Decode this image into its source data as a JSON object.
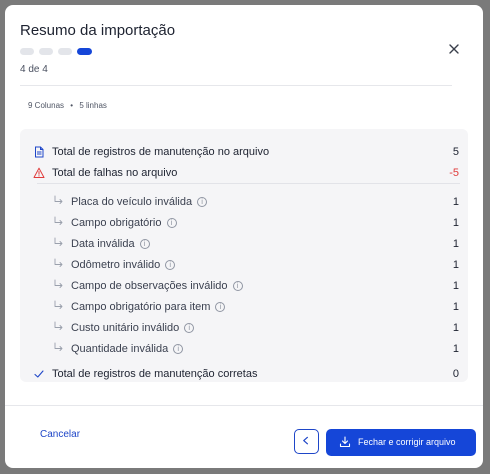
{
  "modal": {
    "title": "Resumo da importação",
    "step_count": "4 de 4",
    "steps_total": 4,
    "steps_current": 4,
    "meta": {
      "columns": "9 Colunas",
      "separator": "•",
      "rows": "5 linhas"
    }
  },
  "summary": {
    "total_records": {
      "label": "Total de registros de manutenção no arquivo",
      "value": "5",
      "icon": "document-icon"
    },
    "total_failures": {
      "label": "Total de falhas no arquivo",
      "value": "-5",
      "icon": "warning-icon"
    },
    "failures": [
      {
        "label": "Placa do veículo inválida",
        "value": "1"
      },
      {
        "label": "Campo obrigatório",
        "value": "1"
      },
      {
        "label": "Data inválida",
        "value": "1"
      },
      {
        "label": "Odômetro inválido",
        "value": "1"
      },
      {
        "label": "Campo de observações inválido",
        "value": "1"
      },
      {
        "label": "Campo obrigatório para item",
        "value": "1"
      },
      {
        "label": "Custo unitário inválido",
        "value": "1"
      },
      {
        "label": "Quantidade inválida",
        "value": "1"
      }
    ],
    "correct_records": {
      "label": "Total de registros de manutenção corretas",
      "value": "0",
      "icon": "check-icon"
    }
  },
  "footer": {
    "cancel_label": "Cancelar",
    "back_icon": "chevron-left-icon",
    "primary_label": "Fechar e corrigir arquivo",
    "primary_icon": "download-icon"
  },
  "colors": {
    "accent": "#1546d8",
    "error": "#e03b3b",
    "panel": "#f5f5f7"
  }
}
